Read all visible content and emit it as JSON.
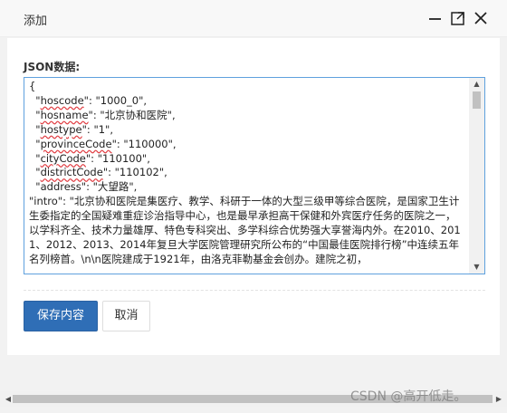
{
  "dialog": {
    "title": "添加",
    "icons": {
      "minimize": "minimize-icon",
      "maximize": "maximize-icon",
      "close": "close-icon"
    }
  },
  "form": {
    "label": "JSON数据:",
    "lines": [
      {
        "pre": "{",
        "key": "",
        "post": ""
      },
      {
        "pre": "  \"",
        "key": "hoscode",
        "post": "\": \"1000_0\","
      },
      {
        "pre": "  \"",
        "key": "hosname",
        "post": "\": \"北京协和医院\","
      },
      {
        "pre": "  \"",
        "key": "hostype",
        "post": "\": \"1\","
      },
      {
        "pre": "  \"",
        "key": "provinceCode",
        "post": "\": \"110000\","
      },
      {
        "pre": "  \"",
        "key": "cityCode",
        "post": "\": \"110100\","
      },
      {
        "pre": "  \"",
        "key": "districtCode",
        "post": "\": \"110102\","
      },
      {
        "pre": "  \"address\": \"大望路\",",
        "key": "",
        "post": ""
      }
    ],
    "intro": "  \"intro\": \"北京协和医院是集医疗、教学、科研于一体的大型三级甲等综合医院，是国家卫生计生委指定的全国疑难重症诊治指导中心，也是最早承担高干保健和外宾医疗任务的医院之一，以学科齐全、技术力量雄厚、特色专科突出、多学科综合优势强大享誉海内外。在2010、2011、2012、2013、2014年复旦大学医院管理研究所公布的“中国最佳医院排行榜”中连续五年名列榜首。\\n\\n医院建成于1921年，由洛克菲勒基金会创办。建院之初，"
  },
  "buttons": {
    "save": "保存内容",
    "cancel": "取消"
  },
  "watermark": "CSDN @高开低走。",
  "colors": {
    "primary": "#2f6eb6",
    "focus_border": "#5fa1de"
  }
}
